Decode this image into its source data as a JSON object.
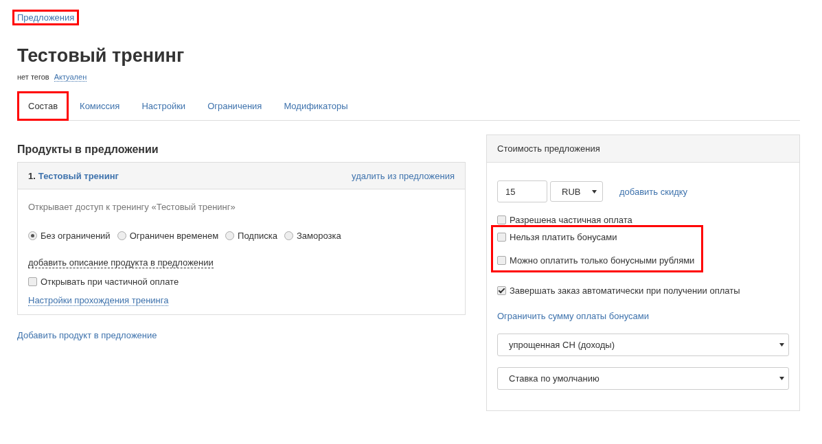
{
  "breadcrumb": {
    "label": "Предложения",
    "highlighted": true
  },
  "title": "Тестовый тренинг",
  "tags": {
    "text": "нет тегов",
    "status": "Актуален"
  },
  "tabs": [
    {
      "label": "Состав",
      "selected": true,
      "highlighted": true
    },
    {
      "label": "Комиссия",
      "selected": false,
      "highlighted": false
    },
    {
      "label": "Настройки",
      "selected": false,
      "highlighted": false
    },
    {
      "label": "Ограничения",
      "selected": false,
      "highlighted": false
    },
    {
      "label": "Модификаторы",
      "selected": false,
      "highlighted": false
    }
  ],
  "products": {
    "heading": "Продукты в предложении",
    "items": [
      {
        "number": "1.",
        "name": "Тестовый тренинг",
        "remove": "удалить из предложения",
        "description": "Открывает доступ к тренингу «Тестовый тренинг»",
        "access_options": [
          {
            "label": "Без ограничений",
            "selected": true
          },
          {
            "label": "Ограничен временем",
            "selected": false
          },
          {
            "label": "Подписка",
            "selected": false
          },
          {
            "label": "Заморозка",
            "selected": false
          }
        ],
        "add_description": "добавить описание продукта в предложении",
        "open_on_partial": {
          "label": "Открывать при частичной оплате",
          "checked": false
        },
        "settings_link": "Настройки прохождения тренинга"
      }
    ],
    "add_product": "Добавить продукт в предложение"
  },
  "price": {
    "header": "Стоимость предложения",
    "amount": "15",
    "currency": "RUB",
    "add_discount": "добавить скидку",
    "checkbox_groups": [
      {
        "highlighted": false,
        "items": [
          {
            "label": "Разрешена частичная оплата",
            "checked": false
          }
        ]
      },
      {
        "highlighted": true,
        "items": [
          {
            "label": "Нельзя платить бонусами",
            "checked": false
          },
          {
            "label": "Можно оплатить только бонусными рублями",
            "checked": false
          }
        ]
      },
      {
        "highlighted": false,
        "items": [
          {
            "label": "Завершать заказ автоматически при получении оплаты",
            "checked": true
          }
        ]
      }
    ],
    "limit_bonus_link": "Ограничить сумму оплаты бонусами",
    "selects": [
      "упрощенная СН (доходы)",
      "Ставка по умолчанию"
    ]
  }
}
